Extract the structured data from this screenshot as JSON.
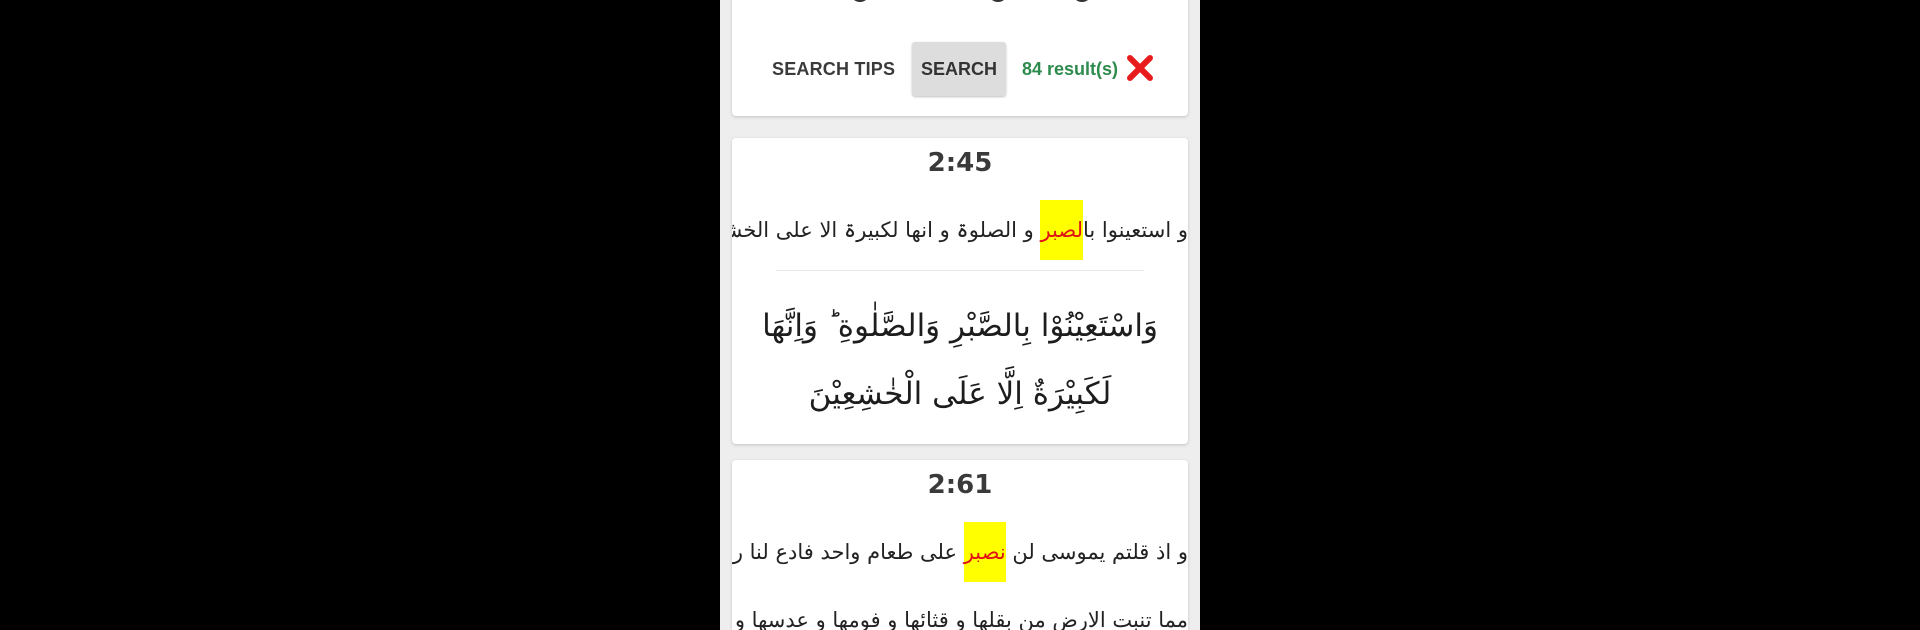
{
  "toolbar": {
    "tips_label": "SEARCH TIPS",
    "search_label": "SEARCH",
    "results_text": "84 result(s)",
    "clear_color": "#e81c1c"
  },
  "verses": [
    {
      "ref": "2:45",
      "plain_before": "و استعینوا با",
      "plain_highlight": "لصبر",
      "plain_after": " و الصلوۃ و انھا لکبیرۃ الا علی الخشعین",
      "arabic": "وَاسْتَعِیْنُوْا بِالصَّبْرِ وَالصَّلٰوةِ ؕ وَاِنَّهَا لَكَبِیْرَةٌ اِلَّا عَلَى الْخٰشِعِیْنَ"
    },
    {
      "ref": "2:61",
      "plain_before": "و اذ قلتم یموسی لن ",
      "plain_highlight": "نصبر",
      "plain_after": " علی طعام واحد فادع لنا ربک یخرج لنا",
      "plain_line2": "مما تنبت الارض من بقلھا و قثائھا و فومھا و عدسھا و بصلھا قال"
    }
  ],
  "colors": {
    "highlight_bg": "#ffff00",
    "highlight_text": "#e01414",
    "results_green": "#2e8b4e"
  }
}
